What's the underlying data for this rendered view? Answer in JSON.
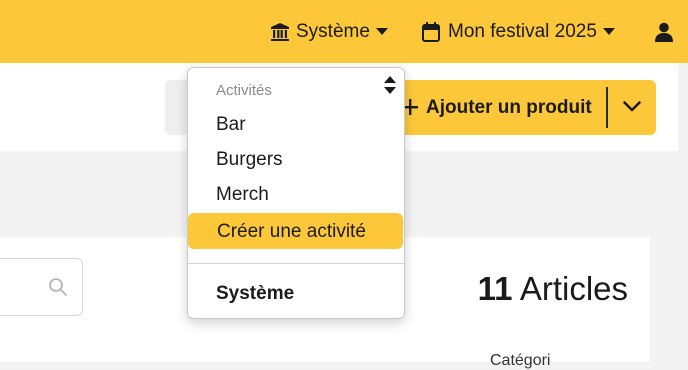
{
  "topbar": {
    "org_label": "Système",
    "event_label": "Mon festival 2025",
    "icons": [
      "institution-icon",
      "calendar-icon",
      "user-icon",
      "caret-down-icon"
    ]
  },
  "toolbar": {
    "add_product_label": "Ajouter un produit"
  },
  "menu": {
    "group_label": "Activités",
    "options": [
      "Bar",
      "Burgers",
      "Merch"
    ],
    "create_label": "Créer une activité",
    "system_label": "Système"
  },
  "content": {
    "article_count": "11",
    "article_word": "Articles",
    "partial_text": "Catégori"
  },
  "colors": {
    "accent": "#fcc83a",
    "page_bg": "#f3f3f3",
    "panel_bg": "#ffffff",
    "muted_text": "#8a8a8a"
  }
}
